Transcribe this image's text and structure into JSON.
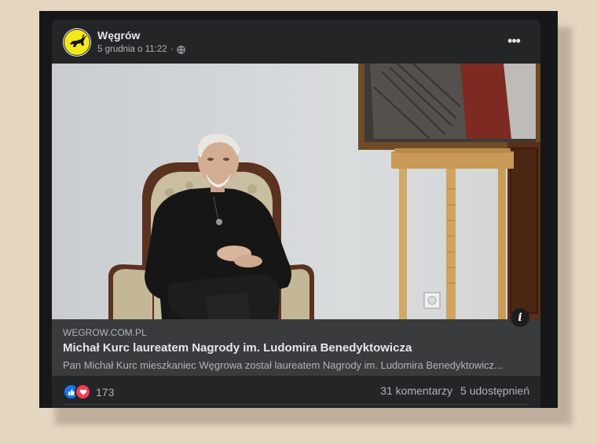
{
  "post": {
    "author": "Węgrów",
    "timestamp": "5 grudnia o 11:22",
    "privacy_icon": "globe-icon",
    "more_icon": "ellipsis-icon"
  },
  "link": {
    "domain": "WEGROW.COM.PL",
    "title": "Michał Kurc laureatem Nagrody im. Ludomira Benedyktowicza",
    "description": "Pan Michał Kurc mieszkaniec Węgrowa został laureatem Nagrody im. Ludomira Benedyktowicz...",
    "info_label": "i"
  },
  "stats": {
    "reaction_count": "173",
    "comments": "31 komentarzy",
    "shares": "5 udostępnień"
  },
  "colors": {
    "card_bg": "#242526",
    "preview_bg": "#3a3b3c",
    "like_blue": "#1877f2",
    "love_red": "#f33e58"
  }
}
